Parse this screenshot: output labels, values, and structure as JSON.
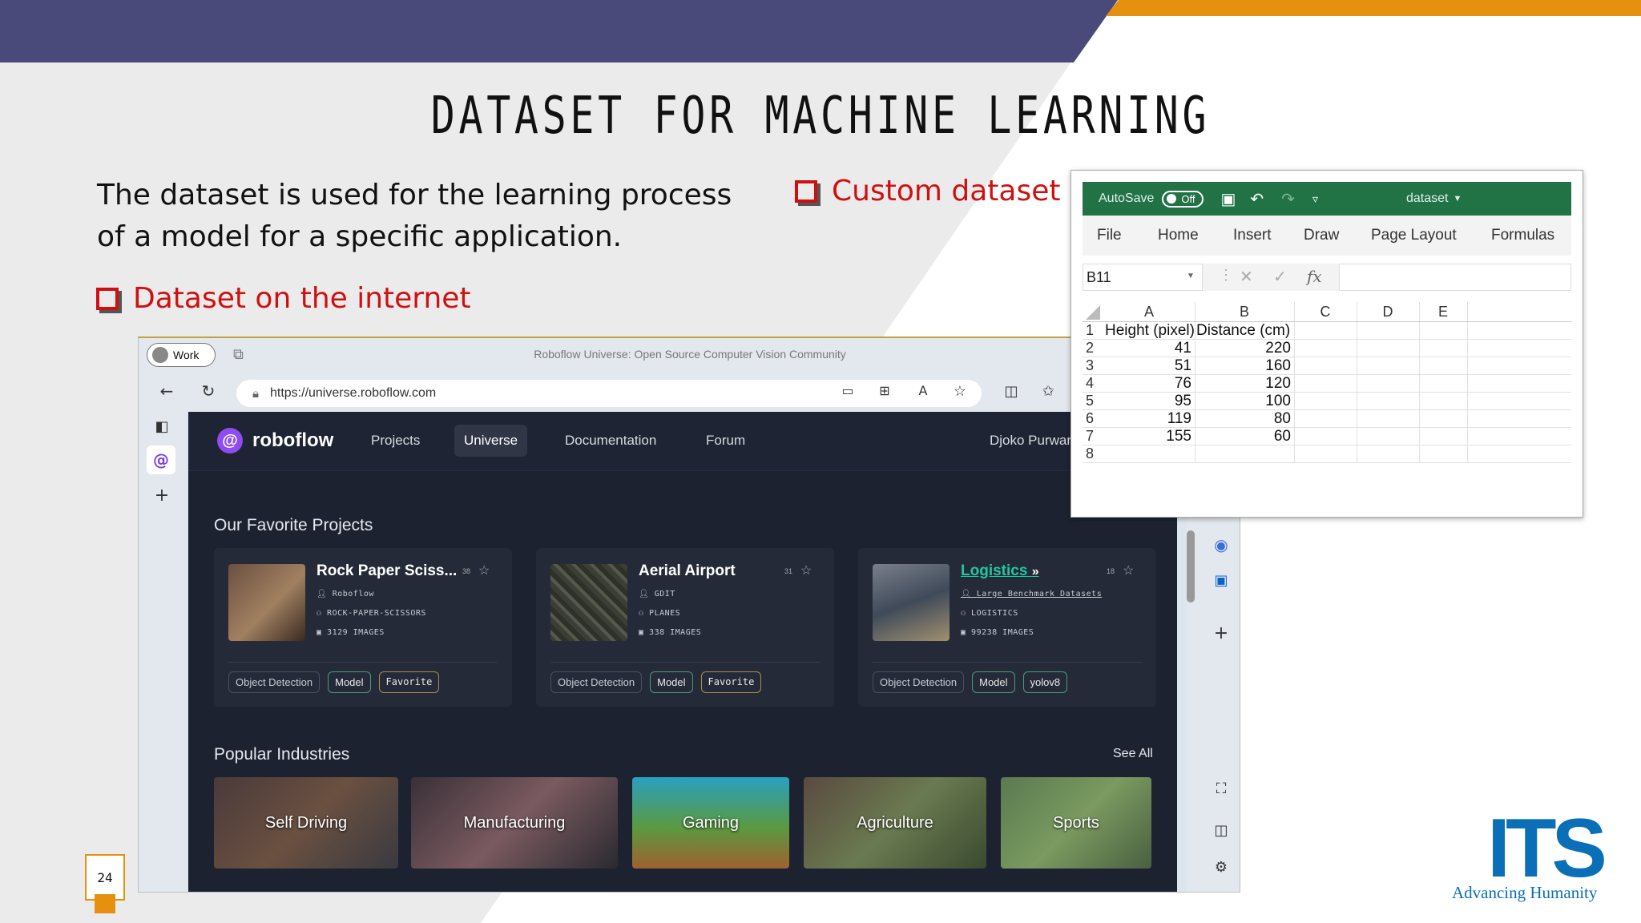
{
  "slide": {
    "title": "DATASET FOR MACHINE LEARNING",
    "description": "The dataset is used for the learning process of a model for a specific application.",
    "bullet_internet": "Dataset on the internet",
    "bullet_custom": "Custom dataset",
    "page_number": "24",
    "logo_text": "ITS",
    "logo_tagline": "Advancing Humanity",
    "colors": {
      "purple_bar": "#4a4a7a",
      "orange": "#e6900f",
      "red": "#d01010"
    }
  },
  "browser": {
    "profile_label": "Work",
    "tab_title": "Roboflow Universe: Open Source Computer Vision Community",
    "url": "https://universe.roboflow.com",
    "header": {
      "brand": "roboflow",
      "nav": [
        "Projects",
        "Universe",
        "Documentation",
        "Forum"
      ],
      "active": "Universe",
      "user": "Djoko Purwar"
    },
    "favorites_heading": "Our Favorite Projects",
    "projects": [
      {
        "title": "Rock Paper Sciss...",
        "count": "38",
        "owner": "Roboflow",
        "class": "ROCK-PAPER-SCISSORS",
        "images": "3129 IMAGES",
        "tags": [
          "Object Detection",
          "Model",
          "Favorite"
        ]
      },
      {
        "title": "Aerial Airport",
        "count": "31",
        "owner": "GDIT",
        "class": "PLANES",
        "images": "338 IMAGES",
        "tags": [
          "Object Detection",
          "Model",
          "Favorite"
        ]
      },
      {
        "title": "Logistics",
        "count": "18",
        "owner": "Large Benchmark Datasets",
        "class": "LOGISTICS",
        "images": "99238 IMAGES",
        "tags": [
          "Object Detection",
          "Model",
          "yolov8"
        ]
      }
    ],
    "industries_heading": "Popular Industries",
    "see_all": "See All",
    "industries": [
      "Self Driving",
      "Manufacturing",
      "Gaming",
      "Agriculture",
      "Sports"
    ]
  },
  "excel": {
    "autosave_label": "AutoSave",
    "autosave_state": "Off",
    "filename": "dataset",
    "menu": [
      "File",
      "Home",
      "Insert",
      "Draw",
      "Page Layout",
      "Formulas"
    ],
    "name_box": "B11",
    "fx_label": "fx",
    "columns": [
      "A",
      "B",
      "C",
      "D",
      "E"
    ],
    "rows": [
      "1",
      "2",
      "3",
      "4",
      "5",
      "6",
      "7",
      "8"
    ],
    "headers": [
      "Height (pixel)",
      "Distance (cm)"
    ],
    "data": [
      [
        "41",
        "220"
      ],
      [
        "51",
        "160"
      ],
      [
        "76",
        "120"
      ],
      [
        "95",
        "100"
      ],
      [
        "119",
        "80"
      ],
      [
        "155",
        "60"
      ]
    ]
  }
}
